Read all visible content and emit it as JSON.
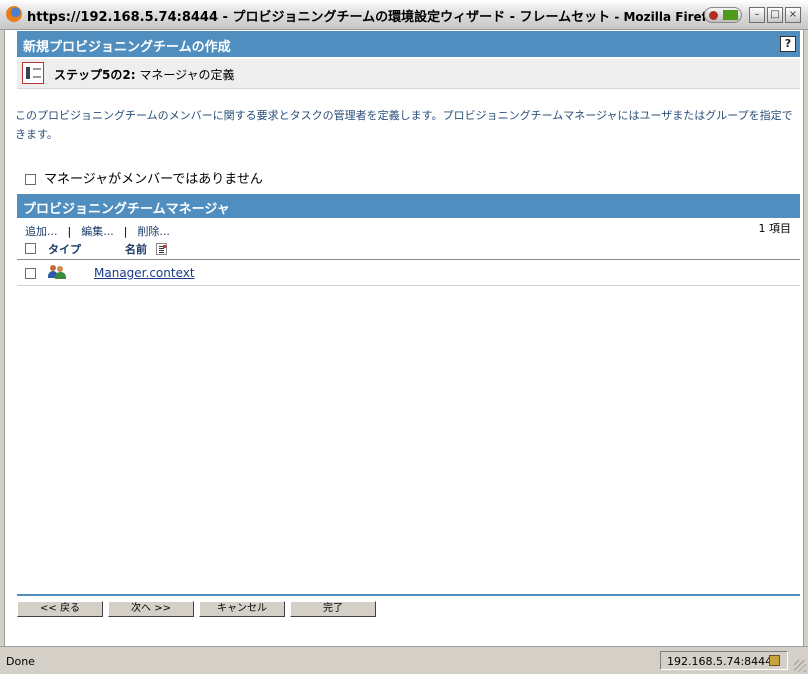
{
  "window": {
    "title_main": "https://192.168.5.74:8444 - プロビジョニングチームの環境設定ウィザード - フレームセット",
    "title_app": " - Mozilla Firefox",
    "minimize": "–",
    "maximize": "□",
    "close": "×"
  },
  "page": {
    "header_title": "新規プロビジョニングチームの作成",
    "help_label": "?",
    "step_label": "ステップ5の2:",
    "step_text": "マネージャの定義",
    "description": "このプロビジョニングチームのメンバーに関する要求とタスクの管理者を定義します。プロビジョニングチームマネージャにはユーザまたはグループを指定できます。",
    "no_manager_label": "マネージャがメンバーではありません"
  },
  "managers": {
    "section_title": "プロビジョニングチームマネージャ",
    "add": "追加...",
    "edit": "編集...",
    "delete": "削除...",
    "separator": "|",
    "count": "1 項目",
    "col_type": "タイプ",
    "col_name": "名前",
    "rows": [
      {
        "name": "Manager.context",
        "type_icon": "users-group-icon"
      }
    ]
  },
  "wizard": {
    "back": "<< 戻る",
    "next": "次へ >>",
    "cancel": "キャンセル",
    "finish": "完了"
  },
  "status": {
    "left": "Done",
    "host": "192.168.5.74:8444"
  },
  "colors": {
    "header_blue": "#4f8ebf",
    "link_blue": "#1a3a8a",
    "description_text": "#2a4e78"
  }
}
